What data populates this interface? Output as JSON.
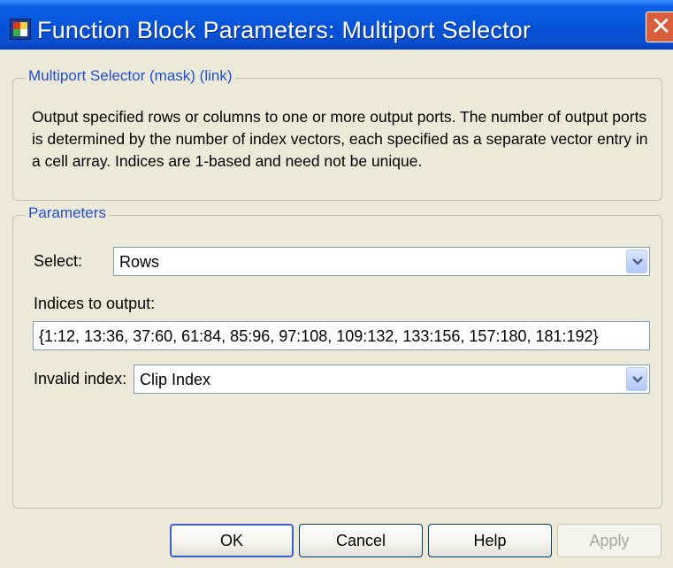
{
  "window": {
    "title": "Function Block Parameters: Multiport Selector",
    "close_glyph": "✕"
  },
  "description_group": {
    "legend": "Multiport Selector (mask) (link)",
    "text": "Output specified rows or columns to one or more output ports.  The number of output ports is determined by the number of index vectors, each specified as a separate vector entry in a cell array.  Indices are 1-based and need not be unique."
  },
  "parameters_group": {
    "legend": "Parameters",
    "select": {
      "label": "Select:",
      "value": "Rows"
    },
    "indices": {
      "label": "Indices to output:",
      "value": "{1:12, 13:36, 37:60, 61:84, 85:96, 97:108, 109:132, 133:156, 157:180, 181:192}"
    },
    "invalid_index": {
      "label": "Invalid index:",
      "value": "Clip Index"
    }
  },
  "buttons": {
    "ok": "OK",
    "cancel": "Cancel",
    "help": "Help",
    "apply": "Apply"
  },
  "colors": {
    "titlebar": "#0653d8",
    "legend_text": "#1f4fcf",
    "dialog_bg": "#ece9d8",
    "close_button": "#d95f3c"
  },
  "icons": {
    "app": "simulink-block-icon",
    "close": "close-icon",
    "dropdown": "chevron-down-icon"
  }
}
